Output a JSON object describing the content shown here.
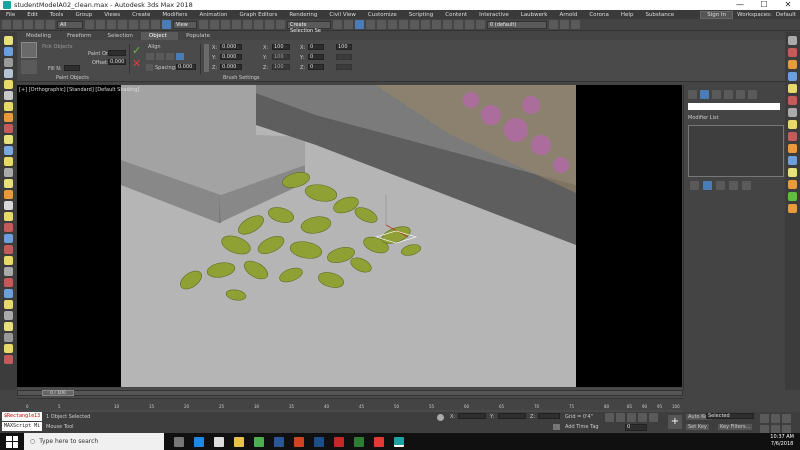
{
  "window": {
    "title": "studentModelA02_clean.max - Autodesk 3ds Max 2018",
    "min": "—",
    "max": "☐",
    "close": "✕"
  },
  "menu": {
    "items": [
      "File",
      "Edit",
      "Tools",
      "Group",
      "Views",
      "Create",
      "Modifiers",
      "Animation",
      "Graph Editors",
      "Rendering",
      "Civil View",
      "Customize",
      "Scripting",
      "Content",
      "Interactive",
      "Laubwerk",
      "Arnold",
      "Corona",
      "Help",
      "Substance"
    ],
    "signin": "Sign In",
    "workspaces_label": "Workspaces:",
    "workspace_value": "Default"
  },
  "toolbar": {
    "filter": "All",
    "view_dropdown": "View",
    "selection_set": "Create Selection Se",
    "layer": "0 (default)"
  },
  "ribbon": {
    "tabs": [
      "Modeling",
      "Freeform",
      "Selection",
      "Object Paint",
      "Populate"
    ],
    "active_tab": 3,
    "pick_objects": "Pick Objects",
    "paint_on": "Paint On:",
    "offset_label": "Offset:",
    "offset_value": "0.000",
    "fill_label": "Fill N:",
    "align_label": "Align",
    "spacing_label": "Spacing:",
    "spacing_value": "0.000",
    "x_label": "X:",
    "y_label": "Y:",
    "z_label": "Z:",
    "rot_x": "0.000",
    "rot_y": "0.000",
    "rot_z": "0.000",
    "scale_x": "100",
    "scale_y": "100",
    "scale_z": "100",
    "scale_p": "100",
    "offset_x": "0",
    "offset_y": "0",
    "offset_z": "0",
    "paint_objects_group": "Paint Objects",
    "brush_settings_group": "Brush Settings"
  },
  "viewport": {
    "label": "[+] [Orthographic] [Standard] [Default Shading]"
  },
  "command_panel": {
    "modifier_list": "Modifier List"
  },
  "timeline": {
    "frame_indicator": "0 / 100",
    "ticks": [
      "0",
      "5",
      "10",
      "15",
      "20",
      "25",
      "30",
      "35",
      "40",
      "45",
      "50",
      "55",
      "60",
      "65",
      "70",
      "75",
      "80",
      "85",
      "90",
      "95",
      "100"
    ]
  },
  "status": {
    "script_line1": "$Rectangle13",
    "script_line2": "MAXScript Mi",
    "selected": "1 Object Selected",
    "tool": "Mouse Tool",
    "x_label": "X:",
    "y_label": "Y:",
    "z_label": "Z:",
    "grid": "Grid = 0'4\"",
    "add_time_tag": "Add Time Tag",
    "frame": "0",
    "auto_key": "Auto Key",
    "selected_dd": "Selected",
    "set_key": "Set Key",
    "key_filters": "Key Filters..."
  },
  "taskbar": {
    "search": "Type here to search",
    "time": "10:37 AM",
    "date": "7/6/2018"
  },
  "colors": {
    "accent": "#4a7db8",
    "leaf": "#8fa035",
    "active_tab": "#5a5a5a"
  }
}
